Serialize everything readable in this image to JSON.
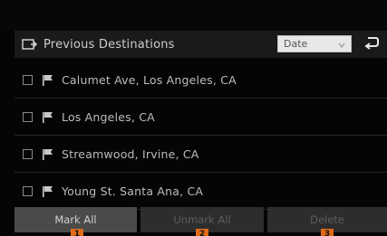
{
  "header": {
    "title": "Previous Destinations",
    "sort_value": "Date"
  },
  "destinations": [
    {
      "label": "Calumet Ave, Los Angeles, CA"
    },
    {
      "label": "Los Angeles, CA"
    },
    {
      "label": "Streamwood, Irvine, CA"
    },
    {
      "label": "Young St. Santa Ana, CA"
    }
  ],
  "actions": {
    "mark_all": "Mark All",
    "unmark_all": "Unmark All",
    "delete": "Delete"
  },
  "callouts": [
    "1",
    "2",
    "3"
  ],
  "colors": {
    "header_bg": "#1a1a1a",
    "button_active": "#4a4a4a",
    "button_disabled": "#2d2d2d",
    "callout": "#e06a18"
  }
}
